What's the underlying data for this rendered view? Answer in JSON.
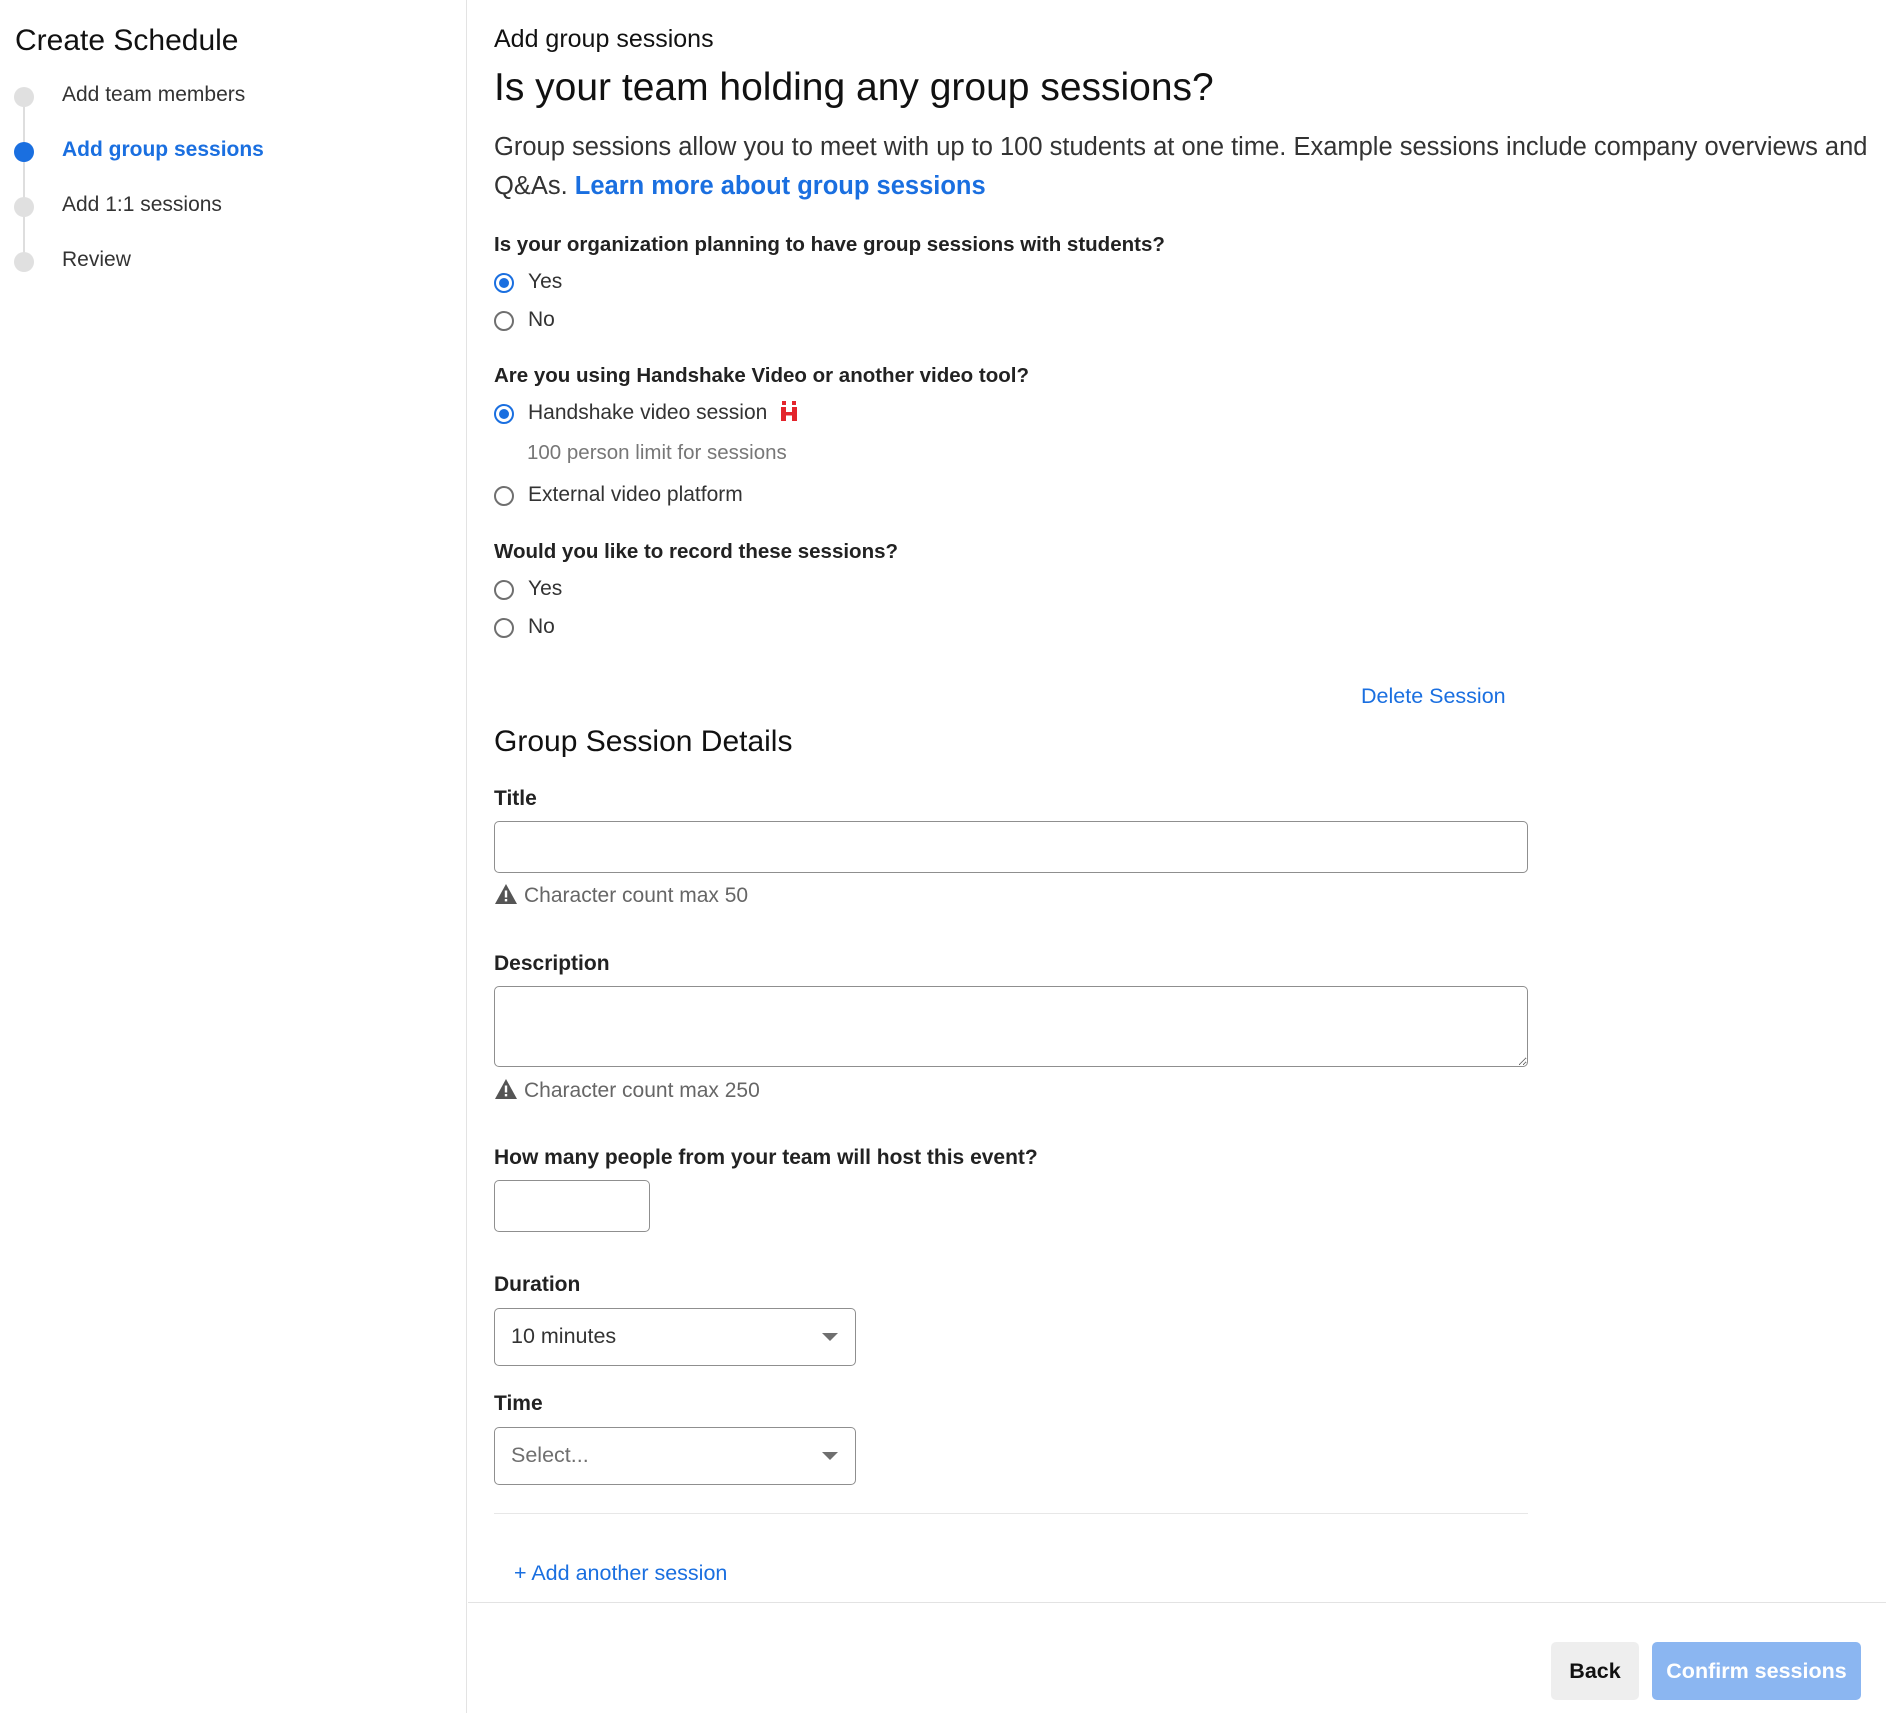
{
  "sidebar": {
    "title": "Create Schedule",
    "steps": [
      {
        "label": "Add team members"
      },
      {
        "label": "Add group sessions"
      },
      {
        "label": "Add 1:1 sessions"
      },
      {
        "label": "Review"
      }
    ],
    "active_step": "Add group sessions"
  },
  "main": {
    "kicker": "Add group sessions",
    "headline": "Is your team holding any group sessions?",
    "intro_text": "Group sessions allow you to meet with up to 100 students at one time. Example sessions include company overviews and Q&As.",
    "intro_link": "Learn more about group sessions",
    "q1": {
      "question": "Is your organization planning to have group sessions with students?",
      "options": [
        "Yes",
        "No"
      ],
      "selected": "Yes"
    },
    "q2": {
      "question": "Are you using Handshake Video or another video tool?",
      "options": [
        "Handshake video session",
        "External video platform"
      ],
      "selected": "Handshake video session",
      "hint": "100 person limit for sessions"
    },
    "q3": {
      "question": "Would you like to record these sessions?",
      "options": [
        "Yes",
        "No"
      ],
      "selected": ""
    },
    "delete_session": "Delete Session",
    "details_title": "Group Session Details",
    "title_field": {
      "label": "Title",
      "value": "",
      "helper": "Character count max 50"
    },
    "description_field": {
      "label": "Description",
      "value": "",
      "helper": "Character count max 250"
    },
    "hosts_field": {
      "label": "How many people from your team will host this event?",
      "value": ""
    },
    "duration_field": {
      "label": "Duration",
      "value": "10 minutes"
    },
    "time_field": {
      "label": "Time",
      "placeholder": "Select..."
    },
    "add_session": "+ Add another session"
  },
  "footer": {
    "back_label": "Back",
    "confirm_label": "Confirm sessions"
  },
  "colors": {
    "accent": "#1a6fe0",
    "confirm_disabled": "#8bb6f1",
    "handshake_red": "#e3242b"
  },
  "icons": {
    "handshake": "handshake-logo-icon",
    "warning": "warning-triangle-icon",
    "dropdown": "chevron-down-icon"
  }
}
